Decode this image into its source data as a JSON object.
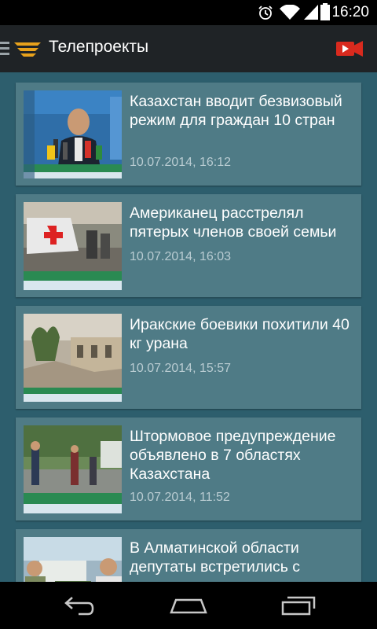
{
  "status_bar": {
    "time": "16:20",
    "icons": [
      "alarm-icon",
      "wifi-icon",
      "signal-icon",
      "battery-icon"
    ]
  },
  "action_bar": {
    "title": "Телепроекты",
    "nav_icon": "drawer-menu-icon",
    "logo": "wings-logo",
    "action_icon": "video-camera-icon",
    "accent_color": "#e8a21c",
    "action_color": "#d92a1e"
  },
  "news": [
    {
      "title": "Казахстан вводит безвизовый режим для граждан 10 стран",
      "date": "10.07.2014, 16:12"
    },
    {
      "title": "Американец расстрелял пятерых членов своей семьи",
      "date": "10.07.2014, 16:03"
    },
    {
      "title": "Иракские боевики похитили 40 кг урана",
      "date": "10.07.2014, 15:57"
    },
    {
      "title": "Штормовое предупреждение объявлено в 7 областях Казахстана",
      "date": "10.07.2014, 11:52"
    },
    {
      "title": "В Алматинской области депутаты встретились с",
      "date": ""
    }
  ],
  "nav_bar": {
    "icons": [
      "back-icon",
      "home-icon",
      "recent-apps-icon"
    ]
  }
}
